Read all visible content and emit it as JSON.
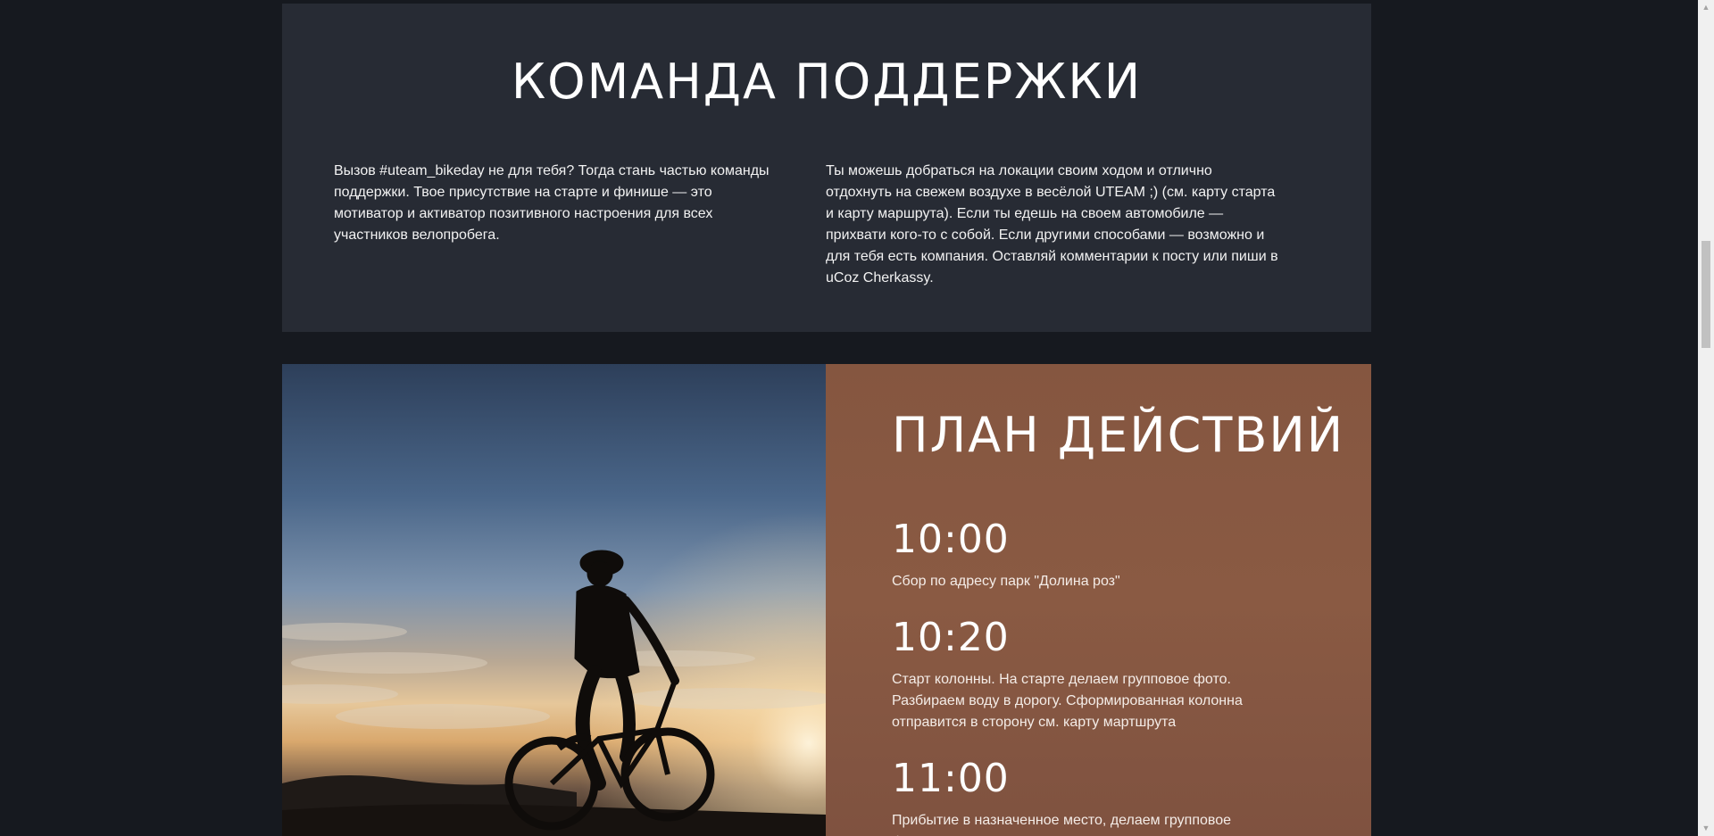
{
  "support": {
    "title": "КОМАНДА ПОДДЕРЖКИ",
    "left_text": "Вызов #uteam_bikeday не для тебя? Тогда стань частью команды поддержки. Твое присутствие на старте и финише — это мотиватор и активатор позитивного настроения для всех участников велопробега.",
    "right_text": "Ты можешь добраться на локации своим ходом и отлично отдохнуть на свежем воздухе в весёлой UTEAM ;) (см. карту старта и карту маршрута). Если ты едешь на своем автомобиле — прихвати кого-то с собой. Если другими способами — возможно и для тебя есть компания. Оставляй комментарии к посту или пиши в uCoz Cherkassy."
  },
  "plan": {
    "title": "ПЛАН ДЕЙСТВИЙ",
    "events": [
      {
        "time": "10:00",
        "description": "Сбор по адресу парк \"Долина роз\""
      },
      {
        "time": "10:20",
        "description": "Старт колонны. На старте делаем групповое фото. Разбираем воду в дорогу. Сформированная колонна отправится в сторону см. карту мартшрута"
      },
      {
        "time": "11:00",
        "description": "Прибытие в назначенное место, делаем групповое фото."
      }
    ]
  },
  "colors": {
    "page_background": "#16191f",
    "support_background": "#272b34",
    "schedule_background": "#8a5a43"
  }
}
